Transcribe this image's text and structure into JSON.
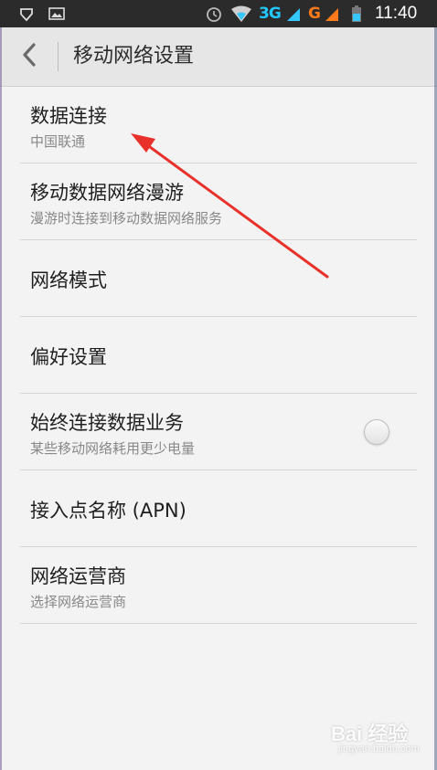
{
  "status_bar": {
    "network_3g": "3G",
    "network_g": "G",
    "time": "11:40",
    "icons": [
      "heart-shield-icon",
      "image-icon",
      "alarm-icon",
      "wifi-icon",
      "signal-icon",
      "battery-icon"
    ],
    "colors": {
      "bg": "#2b2b2b",
      "g3": "#22c7ff",
      "g": "#ff7a1a"
    }
  },
  "action_bar": {
    "title": "移动网络设置",
    "back_icon": "chevron-left-icon"
  },
  "list": {
    "items": [
      {
        "title": "数据连接",
        "subtitle": "中国联通"
      },
      {
        "title": "移动数据网络漫游",
        "subtitle": "漫游时连接到移动数据网络服务"
      },
      {
        "title": "网络模式"
      },
      {
        "title": "偏好设置"
      },
      {
        "title": "始终连接数据业务",
        "subtitle": "某些移动网络耗用更少电量",
        "toggle": false
      },
      {
        "title": "接入点名称 (APN)"
      },
      {
        "title": "网络运营商",
        "subtitle": "选择网络运营商"
      }
    ]
  },
  "annotation": {
    "color": "#e8312a"
  },
  "watermark": {
    "text": "Bai 经验",
    "sub": "jingyan.baidu.com"
  }
}
